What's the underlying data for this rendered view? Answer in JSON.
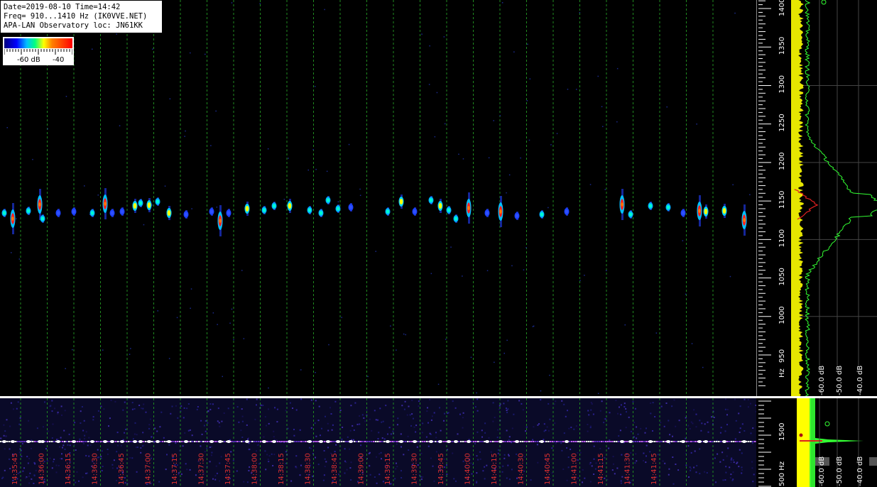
{
  "info": {
    "line1": "Date=2019-08-10 Time=14:42",
    "line2": "Freq= 910...1410 Hz (IK0VVE.NET)",
    "line3": "APA-LAN Observatory loc: JN61KK"
  },
  "color_scale": {
    "low_label": "-60 dB",
    "high_label": "-40",
    "gradient_colors": [
      "#000080",
      "#0000ff",
      "#00c0ff",
      "#00ff80",
      "#ffff00",
      "#ff8000",
      "#ff0000"
    ]
  },
  "time_labels": [
    "14:35:45",
    "14:36:00",
    "14:36:15",
    "14:36:30",
    "14:36:45",
    "14:37:00",
    "14:37:15",
    "14:37:30",
    "14:37:45",
    "14:38:00",
    "14:38:15",
    "14:38:30",
    "14:38:45",
    "14:39:00",
    "14:39:15",
    "14:39:30",
    "14:39:45",
    "14:40:00",
    "14:40:15",
    "14:40:30",
    "14:40:45",
    "14:41:00",
    "14:41:15",
    "14:41:30",
    "14:41:45"
  ],
  "freq_labels": [
    "1400",
    "1350",
    "1300",
    "1250",
    "1200",
    "1150",
    "1100",
    "1050",
    "1000",
    "950"
  ],
  "freq_unit": "Hz",
  "spectrum_db_labels": [
    "-60.0 dB",
    "-50.0 dB",
    "-40.0 dB"
  ],
  "bottom_freq_labels": [
    "1500",
    "500 Hz"
  ],
  "bottom_db_labels": [
    "-60.0 dB",
    "-50.0 dB",
    "-40.0 dB"
  ],
  "colors": {
    "grid_line": "#1f8a1f",
    "time_label": "#e03030",
    "axis_text": "#ffffff",
    "spectrum_green": "#33ff33",
    "spectrum_red": "#dd2020",
    "spectrum_yellow": "#ffff00"
  }
}
